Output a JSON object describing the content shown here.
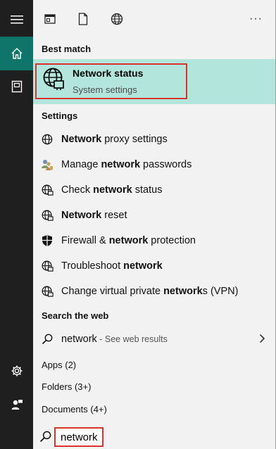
{
  "rail": {
    "menu_icon": "hamburger-menu-icon",
    "home_icon": "home-icon",
    "notebook_icon": "notebook-icon",
    "settings_icon": "gear-icon",
    "feedback_icon": "feedback-icon",
    "accent_color": "#0f7469"
  },
  "topbar": {
    "apps_icon": "app-window-icon",
    "documents_icon": "document-icon",
    "web_icon": "globe-icon",
    "more_label": "···"
  },
  "best_match": {
    "header": "Best match",
    "title": "Network status",
    "subtitle": "System settings",
    "icon": "network-status-globe-icon",
    "highlight_color": "#b2e6dc"
  },
  "settings": {
    "header": "Settings",
    "items": [
      {
        "pre": "",
        "bold": "Network",
        "post": " proxy settings",
        "icon": "globe-icon"
      },
      {
        "pre": "Manage ",
        "bold": "network",
        "post": " passwords",
        "icon": "users-key-icon"
      },
      {
        "pre": "Check ",
        "bold": "network",
        "post": " status",
        "icon": "network-globe-icon"
      },
      {
        "pre": "",
        "bold": "Network",
        "post": " reset",
        "icon": "network-globe-icon"
      },
      {
        "pre": "Firewall & ",
        "bold": "network",
        "post": " protection",
        "icon": "shield-icon"
      },
      {
        "pre": "Troubleshoot ",
        "bold": "network",
        "post": "",
        "icon": "network-globe-icon"
      },
      {
        "pre": "Change virtual private ",
        "bold": "network",
        "post": "s (VPN)",
        "icon": "network-globe-icon"
      }
    ]
  },
  "web": {
    "header": "Search the web",
    "query": "network",
    "hint": " - See web results"
  },
  "categories": {
    "apps": "Apps (2)",
    "folders": "Folders (3+)",
    "documents": "Documents (4+)"
  },
  "search": {
    "value": "network"
  }
}
